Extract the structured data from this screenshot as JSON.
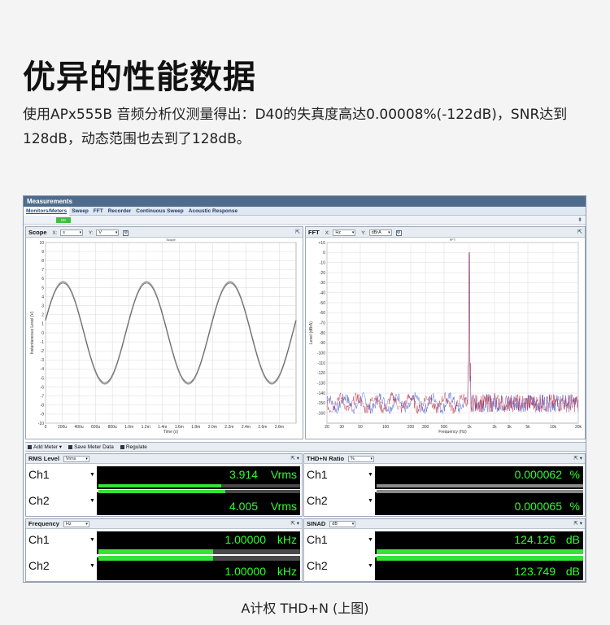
{
  "page": {
    "headline": "优异的性能数据",
    "description": "使用APx555B 音频分析仪测量得出：D40的失真度高达0.00008%(-122dB)，SNR达到128dB，动态范围也去到了128dB。",
    "caption": "A计权 THD+N (上图)"
  },
  "app": {
    "title": "Measurements",
    "tabs": [
      "Monitors/Meters",
      "Sweep",
      "FFT",
      "Recorder",
      "Continuous Sweep",
      "Acoustic Response"
    ],
    "ok_badge": "OK"
  },
  "scope": {
    "title": "Scope",
    "x_axis_label": "X:",
    "x_unit": "s",
    "y_axis_label": "Y:",
    "y_unit": "V",
    "plot_title": "Scope",
    "xlabel": "Time (s)",
    "ylabel": "Instantaneous Level (V)",
    "x_ticks": [
      "0",
      "200u",
      "400u",
      "600u",
      "800u",
      "1.0m",
      "1.2m",
      "1.4m",
      "1.6m",
      "1.8m",
      "2.0m",
      "2.2m",
      "2.4m",
      "2.6m",
      "2.8m"
    ],
    "y_ticks": [
      "10",
      "9",
      "8",
      "7",
      "6",
      "5",
      "4",
      "3",
      "2",
      "1",
      "0",
      "-1",
      "-2",
      "-3",
      "-4",
      "-5",
      "-6",
      "-7",
      "-8",
      "-9",
      "-10"
    ]
  },
  "fft": {
    "title": "FFT",
    "x_axis_label": "X:",
    "x_unit": "Hz",
    "y_axis_label": "Y:",
    "y_unit": "dBrA",
    "plot_title": "FFT",
    "xlabel": "Frequency (Hz)",
    "ylabel": "Level (dBrA)",
    "x_ticks": [
      "20",
      "30",
      "50",
      "100",
      "200",
      "300",
      "500",
      "1k",
      "2k",
      "3k",
      "5k",
      "10k",
      "20k"
    ],
    "y_ticks": [
      "+10",
      "0",
      "-10",
      "-20",
      "-30",
      "-40",
      "-50",
      "-60",
      "-70",
      "-80",
      "-90",
      "-100",
      "-110",
      "-120",
      "-130",
      "-140",
      "-150",
      "-160"
    ]
  },
  "meter_toolbar": {
    "add_meter": "Add Meter",
    "save_meter_data": "Save Meter Data",
    "regulate": "Regulate"
  },
  "meters": {
    "rms": {
      "title": "RMS Level",
      "unit_select": "Vrms",
      "ch1": {
        "label": "Ch1",
        "value": "3.914",
        "unit": "Vrms",
        "bar_fraction": 0.61
      },
      "ch2": {
        "label": "Ch2",
        "value": "4.005",
        "unit": "Vrms",
        "bar_fraction": 0.63
      }
    },
    "thd": {
      "title": "THD+N Ratio",
      "unit_select": "%",
      "ch1": {
        "label": "Ch1",
        "value": "0.000062",
        "unit": "%",
        "bar_fraction": 0.0
      },
      "ch2": {
        "label": "Ch2",
        "value": "0.000065",
        "unit": "%",
        "bar_fraction": 0.0
      }
    },
    "freq": {
      "title": "Frequency",
      "unit_select": "Hz",
      "ch1": {
        "label": "Ch1",
        "value": "1.00000",
        "unit": "kHz",
        "bar_fraction": 0.57
      },
      "ch2": {
        "label": "Ch2",
        "value": "1.00000",
        "unit": "kHz",
        "bar_fraction": 0.57
      }
    },
    "sinad": {
      "title": "SINAD",
      "unit_select": "dB",
      "ch1": {
        "label": "Ch1",
        "value": "124.126",
        "unit": "dB",
        "bar_fraction": 1.0
      },
      "ch2": {
        "label": "Ch2",
        "value": "123.749",
        "unit": "dB",
        "bar_fraction": 1.0
      }
    }
  },
  "colors": {
    "readout_green": "#2cff2c",
    "bar_green": "#36e236",
    "trace_gray": "#777777",
    "fft_red": "#b0203a",
    "fft_blue": "#3040c0"
  }
}
